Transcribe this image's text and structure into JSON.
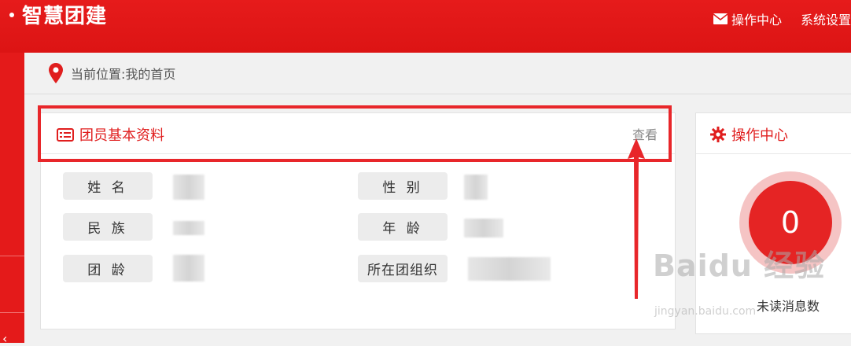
{
  "header": {
    "brand": "智慧团建",
    "nav": [
      {
        "label": "操作中心",
        "icon": "envelope-icon"
      },
      {
        "label": "系统设置 ",
        "icon": "chevron-down-icon"
      }
    ]
  },
  "breadcrumb": {
    "text": "当前位置:我的首页",
    "icon": "location-pin-icon"
  },
  "profile": {
    "title": "团员基本资料",
    "view": "查看",
    "fields": [
      {
        "label": "姓 名"
      },
      {
        "label": "性 别"
      },
      {
        "label": "民 族"
      },
      {
        "label": "年 龄"
      },
      {
        "label": "团 龄"
      },
      {
        "label": "所在团组织"
      }
    ]
  },
  "ops": {
    "title": "操作中心",
    "unread_count": "0",
    "unread_label": "未读消息数"
  },
  "watermark": {
    "main": "Baidu 经验",
    "sub": "jingyan.baidu.com"
  },
  "colors": {
    "brand_red": "#e31b1b",
    "highlight_red": "#e8262a"
  }
}
